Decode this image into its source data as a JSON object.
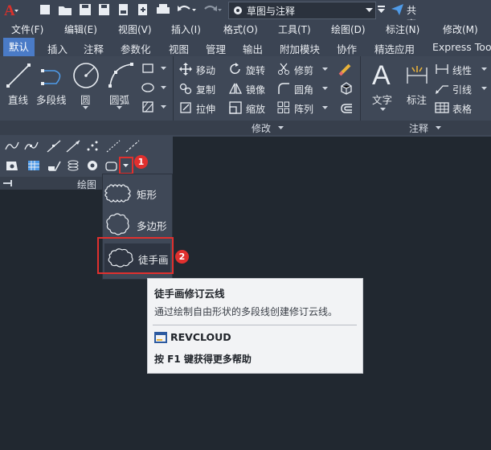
{
  "title_bar": {
    "workspace": "草图与注释",
    "share": "共享"
  },
  "menu": [
    "文件(F)",
    "编辑(E)",
    "视图(V)",
    "插入(I)",
    "格式(O)",
    "工具(T)",
    "绘图(D)",
    "标注(N)",
    "修改(M)"
  ],
  "tabs": [
    "默认",
    "插入",
    "注释",
    "参数化",
    "视图",
    "管理",
    "输出",
    "附加模块",
    "协作",
    "精选应用",
    "Express Too"
  ],
  "active_tab": "默认",
  "draw_panel": {
    "buttons": [
      "直线",
      "多段线",
      "圆",
      "圆弧"
    ],
    "title": "绘图"
  },
  "modify_panel": {
    "rows": [
      [
        "移动",
        "旋转",
        "修剪"
      ],
      [
        "复制",
        "镜像",
        "圆角"
      ],
      [
        "拉伸",
        "缩放",
        "阵列"
      ]
    ],
    "title": "修改"
  },
  "annotation_panel": {
    "big_buttons": [
      "文字",
      "标注"
    ],
    "small_buttons": [
      "线性",
      "引线",
      "表格"
    ],
    "title": "注释"
  },
  "dropdown": {
    "items": [
      "矩形",
      "多边形",
      "徒手画"
    ],
    "selected": "徒手画"
  },
  "callouts": [
    "1",
    "2"
  ],
  "tooltip": {
    "title": "徒手画修订云线",
    "description": "通过绘制自由形状的多段线创建修订云线。",
    "command": "REVCLOUD",
    "help": "按 F1 键获得更多帮助"
  },
  "colors": {
    "accent_tab": "#4a7bc7",
    "highlight": "#e0302e",
    "canvas": "#212830",
    "ribbon": "#3f4857"
  }
}
